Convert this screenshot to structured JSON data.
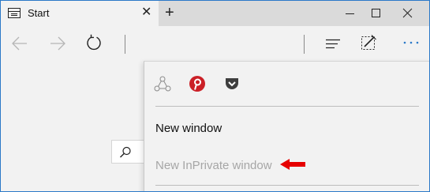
{
  "tab": {
    "icon": "start-page-icon",
    "title": "Start",
    "close_icon": "close-icon"
  },
  "titlebar": {
    "new_tab_icon": "plus-icon",
    "window_controls": [
      "minimize-icon",
      "maximize-icon",
      "close-icon"
    ]
  },
  "toolbar": {
    "left_icons": [
      "back-arrow-icon",
      "forward-arrow-icon",
      "refresh-icon"
    ],
    "right_icons": [
      "hub-icon",
      "web-note-icon",
      "more-actions-icon"
    ]
  },
  "page": {
    "search_icon": "search-icon"
  },
  "menu": {
    "share_icons": [
      "share-icon",
      "pinterest-icon",
      "pocket-icon"
    ],
    "items": [
      {
        "label": "New window",
        "enabled": true
      },
      {
        "label": "New InPrivate window",
        "enabled": false
      }
    ]
  },
  "annotation": {
    "arrow_icon": "red-arrow-icon",
    "color": "#e60000"
  },
  "colors": {
    "accent_border": "#2b79c8",
    "titlebar_bg": "#dadada",
    "tab_bg": "#f2f2f2",
    "toolbar_bg": "#f2f2f2",
    "menu_bg": "#f2f2f2",
    "more_actions": "#2b79c8",
    "pinterest": "#cb2027",
    "pocket": "#3e3e3e",
    "disabled_text": "#a6a6a6"
  }
}
